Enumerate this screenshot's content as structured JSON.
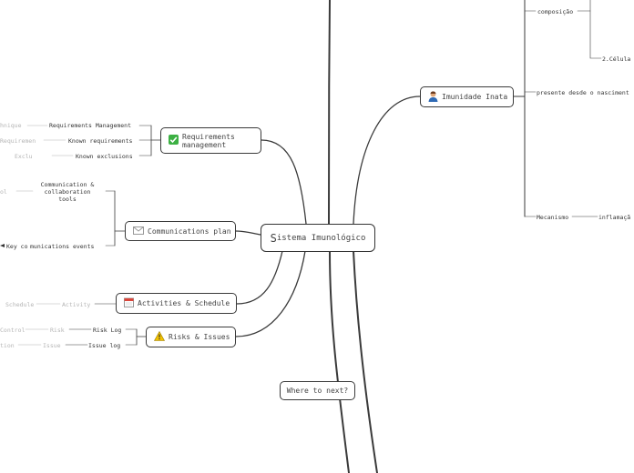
{
  "central": {
    "initial": "S",
    "rest": "istema Imunológico"
  },
  "next_topic": "Where to next?",
  "topics": {
    "imunidade": "Imunidade Inata",
    "requirements": "Requirements management",
    "communications": "Communications plan",
    "activities": "Activities & Schedule",
    "risks": "Risks & Issues"
  },
  "imunidade_children": {
    "composicao": "composição",
    "celulas": "2.Célula",
    "presente": "presente desde o nasciment",
    "mecanismo": "Mecanismo",
    "inflamacao": "inflamaçã"
  },
  "requirements_children": {
    "req_mgmt": "Requirements Management",
    "req_mgmt_sub": "hnique",
    "known_req": "Known requirements",
    "known_req_sub": "Requiremen",
    "known_excl": "Known exclusions",
    "known_excl_sub": "Exclu"
  },
  "communications_children": {
    "tools": "Communication & collaboration tools",
    "tools_sub": "ol",
    "events": "munications events",
    "events_sub": "Key co"
  },
  "activities_children": {
    "activity": "Activity",
    "schedule": "Schedule"
  },
  "risks_children": {
    "risk_log": "Risk Log",
    "risk": "Risk",
    "control": "Control",
    "issue_log": "Issue log",
    "issue": "Issue",
    "action": "tion"
  },
  "colors": {
    "line": "#3a3a3a",
    "faded": "#b5b5b5",
    "check": "#3cb043",
    "warn": "#f2c200"
  }
}
